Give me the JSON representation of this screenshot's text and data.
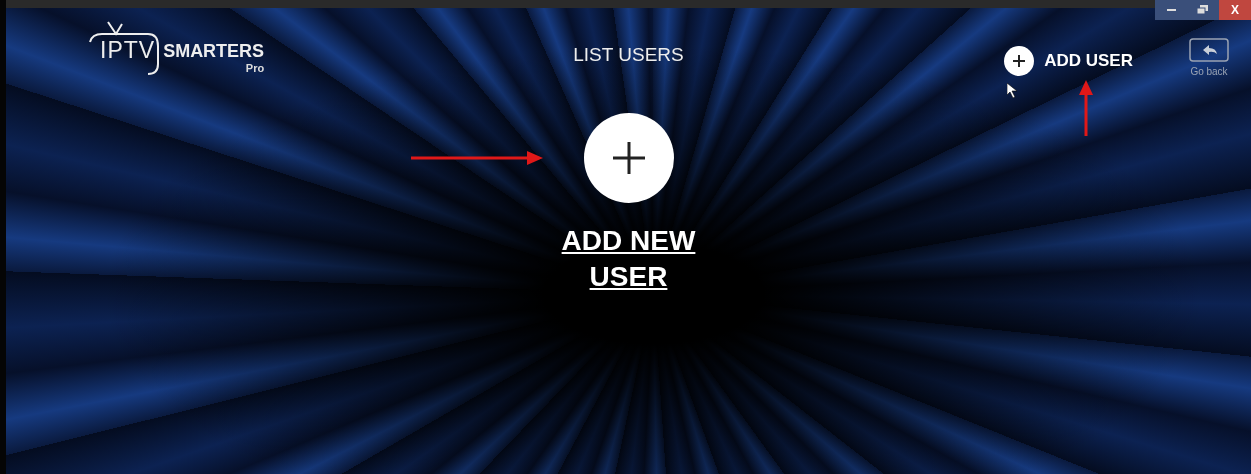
{
  "window_controls": {
    "close": "X"
  },
  "logo": {
    "iptv": "IPTV",
    "brand": "SMARTERS",
    "edition": "Pro"
  },
  "title": "LIST USERS",
  "add_user": {
    "label": "ADD USER"
  },
  "go_back": {
    "label": "Go back"
  },
  "add_new_user": {
    "label": "ADD NEW USER"
  }
}
